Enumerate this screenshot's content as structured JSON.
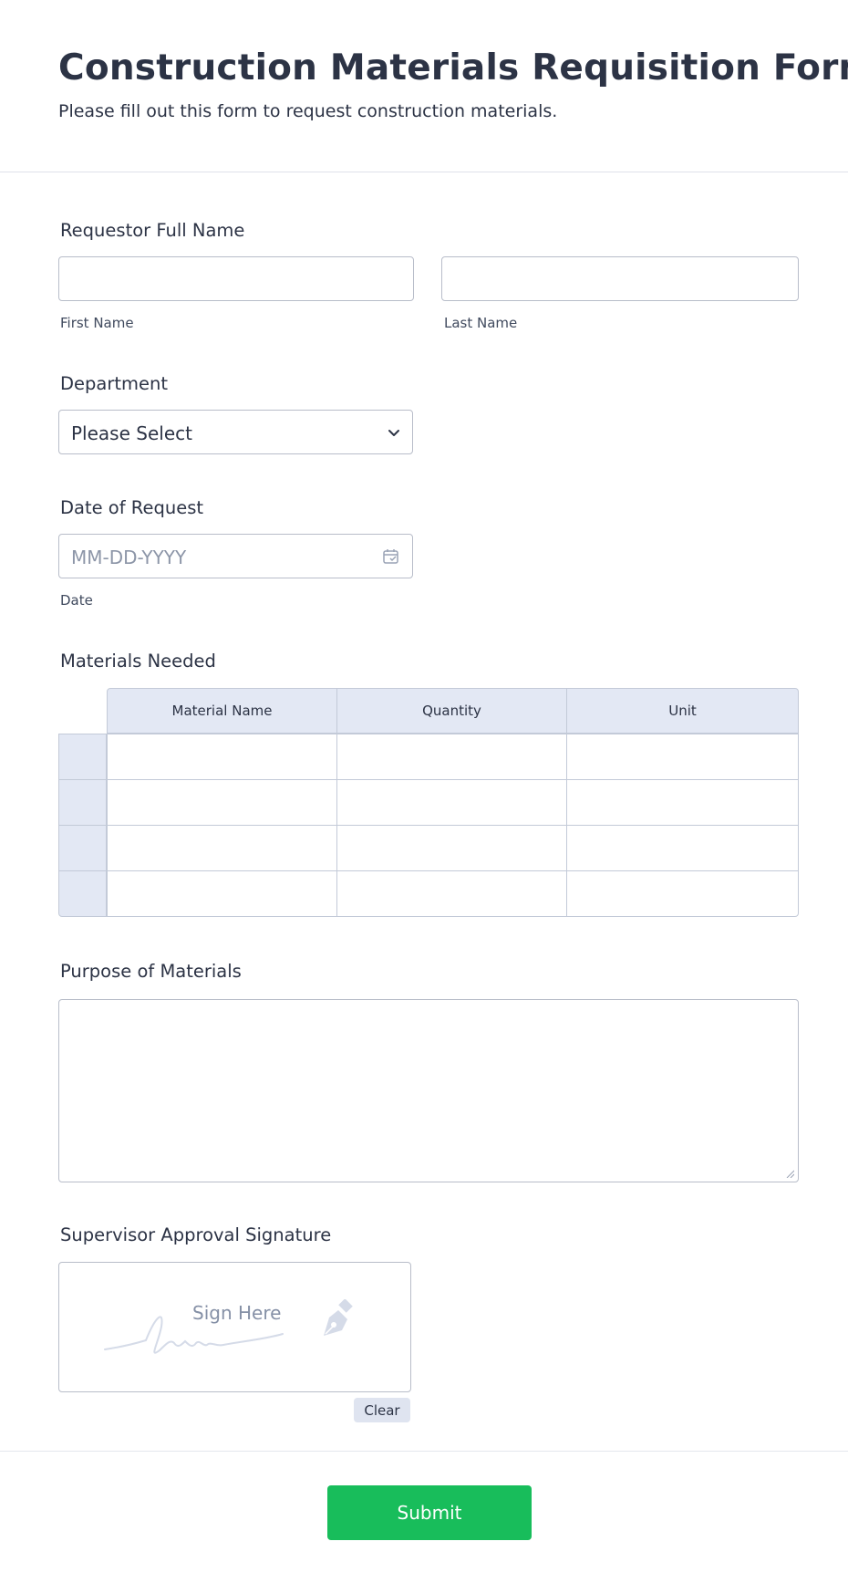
{
  "header": {
    "title": "Construction Materials Requisition Form",
    "subtitle": "Please fill out this form to request construction materials."
  },
  "name_field": {
    "label": "Requestor Full Name",
    "first_sublabel": "First Name",
    "last_sublabel": "Last Name",
    "first_value": "",
    "last_value": ""
  },
  "department": {
    "label": "Department",
    "selected": "Please Select",
    "icon": "chevron-down-icon"
  },
  "date_field": {
    "label": "Date of Request",
    "placeholder": "MM-DD-YYYY",
    "sublabel": "Date",
    "icon": "calendar-icon"
  },
  "materials": {
    "label": "Materials Needed",
    "columns": [
      "Material Name",
      "Quantity",
      "Unit"
    ],
    "row_count": 4
  },
  "purpose": {
    "label": "Purpose of Materials",
    "value": ""
  },
  "signature": {
    "label": "Supervisor Approval Signature",
    "hint": "Sign Here",
    "clear_label": "Clear",
    "icon": "pen-nib-icon"
  },
  "submit_label": "Submit",
  "colors": {
    "text": "#2c3345",
    "border": "#b8bdc9",
    "table_header": "#e3e8f4",
    "submit": "#18bd5b"
  }
}
